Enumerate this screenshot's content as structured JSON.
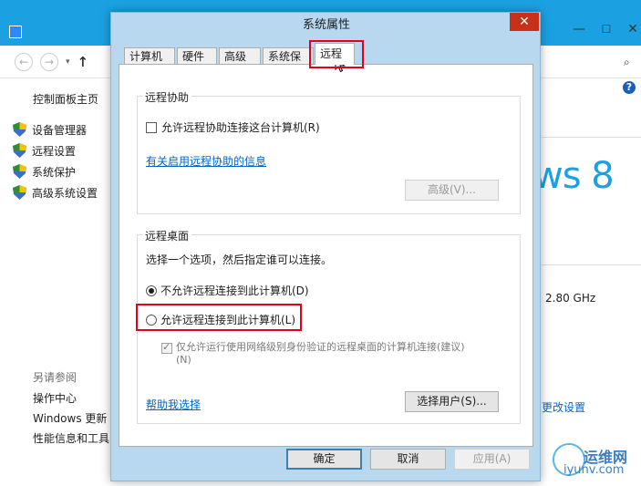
{
  "background_window": {
    "sidebar_title": "控制面板主页",
    "sidebar_items": [
      {
        "label": "设备管理器"
      },
      {
        "label": "远程设置"
      },
      {
        "label": "系统保护"
      },
      {
        "label": "高级系统设置"
      }
    ],
    "see_also_title": "另请参阅",
    "see_also_items": [
      {
        "label": "操作中心"
      },
      {
        "label": "Windows 更新"
      },
      {
        "label": "性能信息和工具"
      }
    ],
    "logo_text": "ws 8",
    "cpu_speed": "2.80 GHz",
    "change_settings_link": "更改设置",
    "help_icon_glyph": "?"
  },
  "dialog": {
    "title": "系统属性",
    "close_glyph": "✕",
    "tabs": [
      {
        "label": "计算机名"
      },
      {
        "label": "硬件"
      },
      {
        "label": "高级"
      },
      {
        "label": "系统保护"
      },
      {
        "label": "远程"
      }
    ],
    "active_tab": "远程",
    "remote_assistance": {
      "legend": "远程协助",
      "allow_checkbox_label": "允许远程协助连接这台计算机(R)",
      "allow_checked": false,
      "info_link": "有关启用远程协助的信息",
      "advanced_button": "高级(V)..."
    },
    "remote_desktop": {
      "legend": "远程桌面",
      "instruction": "选择一个选项，然后指定谁可以连接。",
      "option_deny": "不允许远程连接到此计算机(D)",
      "option_allow": "允许远程连接到此计算机(L)",
      "selected": "deny",
      "nla_label_line1": "仅允许运行使用网络级别身份验证的远程桌面的计算机连接(建议)",
      "nla_label_line2": "(N)",
      "nla_checked": true,
      "help_link": "帮助我选择",
      "select_users_button": "选择用户(S)..."
    },
    "footer": {
      "ok": "确定",
      "cancel": "取消",
      "apply": "应用(A)"
    }
  },
  "watermark": {
    "line1": "运维网",
    "line2": "iyunv.com"
  },
  "colors": {
    "accent": "#1ba1e2",
    "dialog_frame": "#b7d8ef",
    "highlight_red": "#e2001a",
    "close_red": "#c7311a",
    "link_blue": "#0066cc"
  }
}
